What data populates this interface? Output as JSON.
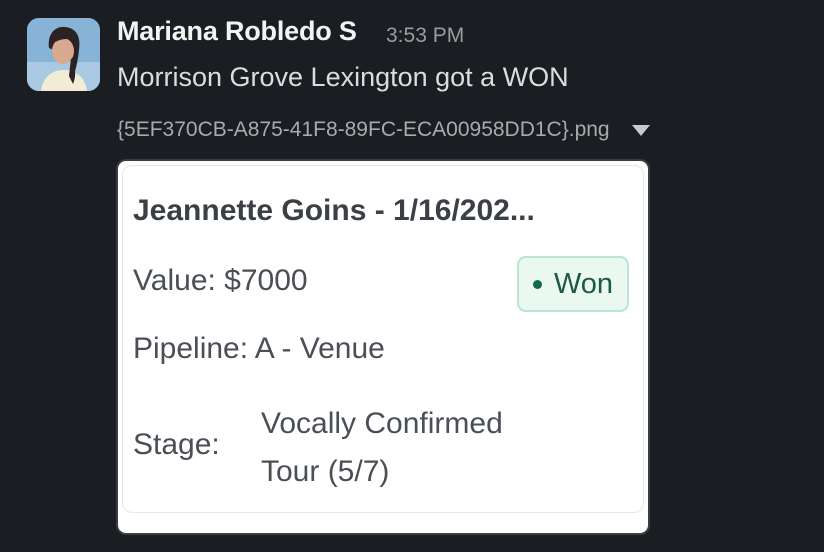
{
  "message": {
    "sender": "Mariana Robledo S",
    "timestamp": "3:53 PM",
    "text": "Morrison Grove Lexington got a WON",
    "file_name": "{5EF370CB-A875-41F8-89FC-ECA00958DD1C}.png",
    "avatar_icon": "profile-photo"
  },
  "card": {
    "title": "Jeannette Goins - 1/16/202...",
    "value": "Value: $7000",
    "status": "Won",
    "pipeline": "Pipeline: A - Venue",
    "stage_label": "Stage:",
    "stage_line1": "Vocally Confirmed",
    "stage_line2": "Tour (5/7)"
  },
  "colors": {
    "background": "#1a1d21",
    "status_green": "#0e6b4a",
    "status_bg": "#eaf8f1"
  }
}
